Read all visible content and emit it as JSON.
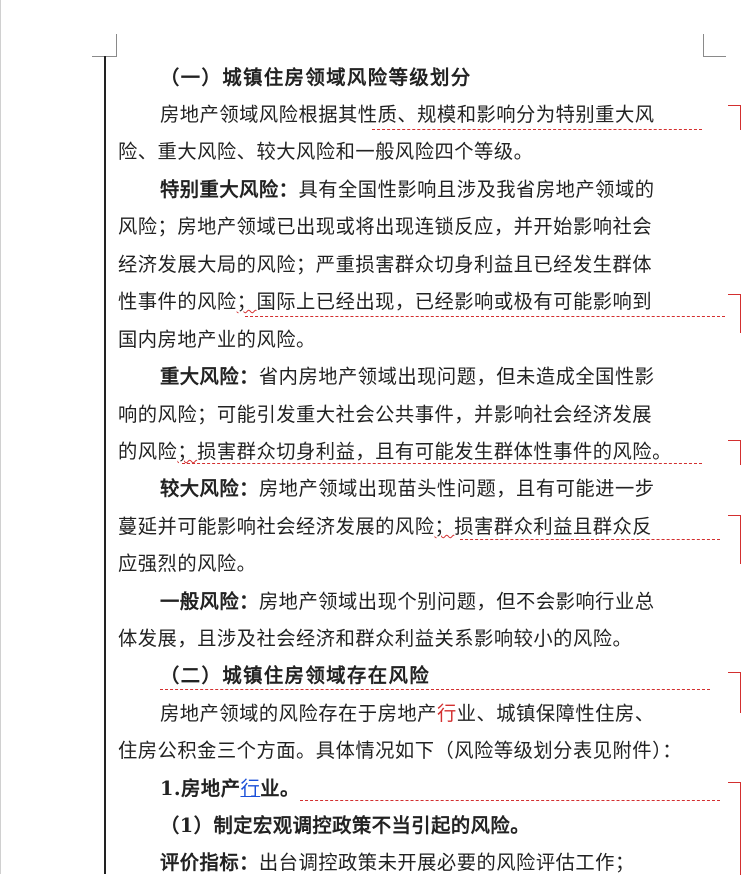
{
  "document": {
    "lines": [
      {
        "parts": [
          {
            "text": "（一）城镇住房领域风险等级划分",
            "style": "bold"
          }
        ]
      },
      {
        "parts": [
          {
            "text": "房地产领域风险根据其性质、规模和影响分为特别重大风"
          }
        ]
      },
      {
        "parts": [
          {
            "text": "险、重大风险、较大风险和一般风险四个等级。"
          }
        ]
      },
      {
        "parts": [
          {
            "text": "特别重大风险：",
            "style": "bold"
          },
          {
            "text": "具有全国性影响且涉及我省房地产领域的"
          }
        ]
      },
      {
        "parts": [
          {
            "text": "风险；房地产领域已出现或将出现连锁反应，并开始影响社会"
          }
        ]
      },
      {
        "parts": [
          {
            "text": "经济发展大局的风险；严重损害群众切身利益且已经发生群体"
          }
        ]
      },
      {
        "parts": [
          {
            "text": "性事件的风险"
          },
          {
            "text": "；",
            "style": "squiggle"
          },
          {
            "text": "国际上已经出现，已经影响或极有可能影响到"
          }
        ]
      },
      {
        "parts": [
          {
            "text": "国内房地产业的风险。"
          }
        ]
      },
      {
        "parts": [
          {
            "text": "重大风险：",
            "style": "bold"
          },
          {
            "text": "省内房地产领域出现问题，但未造成全国性影"
          }
        ]
      },
      {
        "parts": [
          {
            "text": "响的风险；可能引发重大社会公共事件，并影响社会经济发展"
          }
        ]
      },
      {
        "parts": [
          {
            "text": "的风险"
          },
          {
            "text": "；",
            "style": "squiggle"
          },
          {
            "text": "损害群众切身利益，且有可能发生群体性事件的风险。"
          }
        ]
      },
      {
        "parts": [
          {
            "text": "较大风险：",
            "style": "bold"
          },
          {
            "text": "房地产领域出现苗头性问题，且有可能进一步"
          }
        ]
      },
      {
        "parts": [
          {
            "text": "蔓延并可能影响社会经济发展的风险"
          },
          {
            "text": "；",
            "style": "squiggle"
          },
          {
            "text": "损害群众利益且群众反"
          }
        ]
      },
      {
        "parts": [
          {
            "text": "应强烈的风险。"
          }
        ]
      },
      {
        "parts": [
          {
            "text": "一般风险：",
            "style": "bold"
          },
          {
            "text": "房地产领域出现个别问题，但不会影响行业总"
          }
        ]
      },
      {
        "parts": [
          {
            "text": "体发展，且涉及社会经济和群众利益关系影响较小的风险。"
          }
        ]
      },
      {
        "parts": [
          {
            "text": "（二）城镇住房领域存在风险",
            "style": "bold"
          }
        ]
      },
      {
        "parts": [
          {
            "text": "房地产领域的风险存在于房地产"
          },
          {
            "text": "行",
            "style": "red"
          },
          {
            "text": "业、城镇保障性住房、"
          }
        ]
      },
      {
        "parts": [
          {
            "text": "住房公积金三个方面。具体情况如下（风险等级划分表见附件）："
          }
        ]
      },
      {
        "parts": [
          {
            "text": "1.房地产",
            "style": "bold"
          },
          {
            "text": "行",
            "style": "blue"
          },
          {
            "text": "业。",
            "style": "bold"
          }
        ]
      },
      {
        "parts": [
          {
            "text": "（1）制定宏观调控政策不当引起的风险。",
            "style": "bold"
          }
        ]
      },
      {
        "parts": [
          {
            "text": "评价指标：",
            "style": "bold"
          },
          {
            "text": "出台调控政策未开展必要的风险评估工作；"
          }
        ]
      }
    ]
  }
}
